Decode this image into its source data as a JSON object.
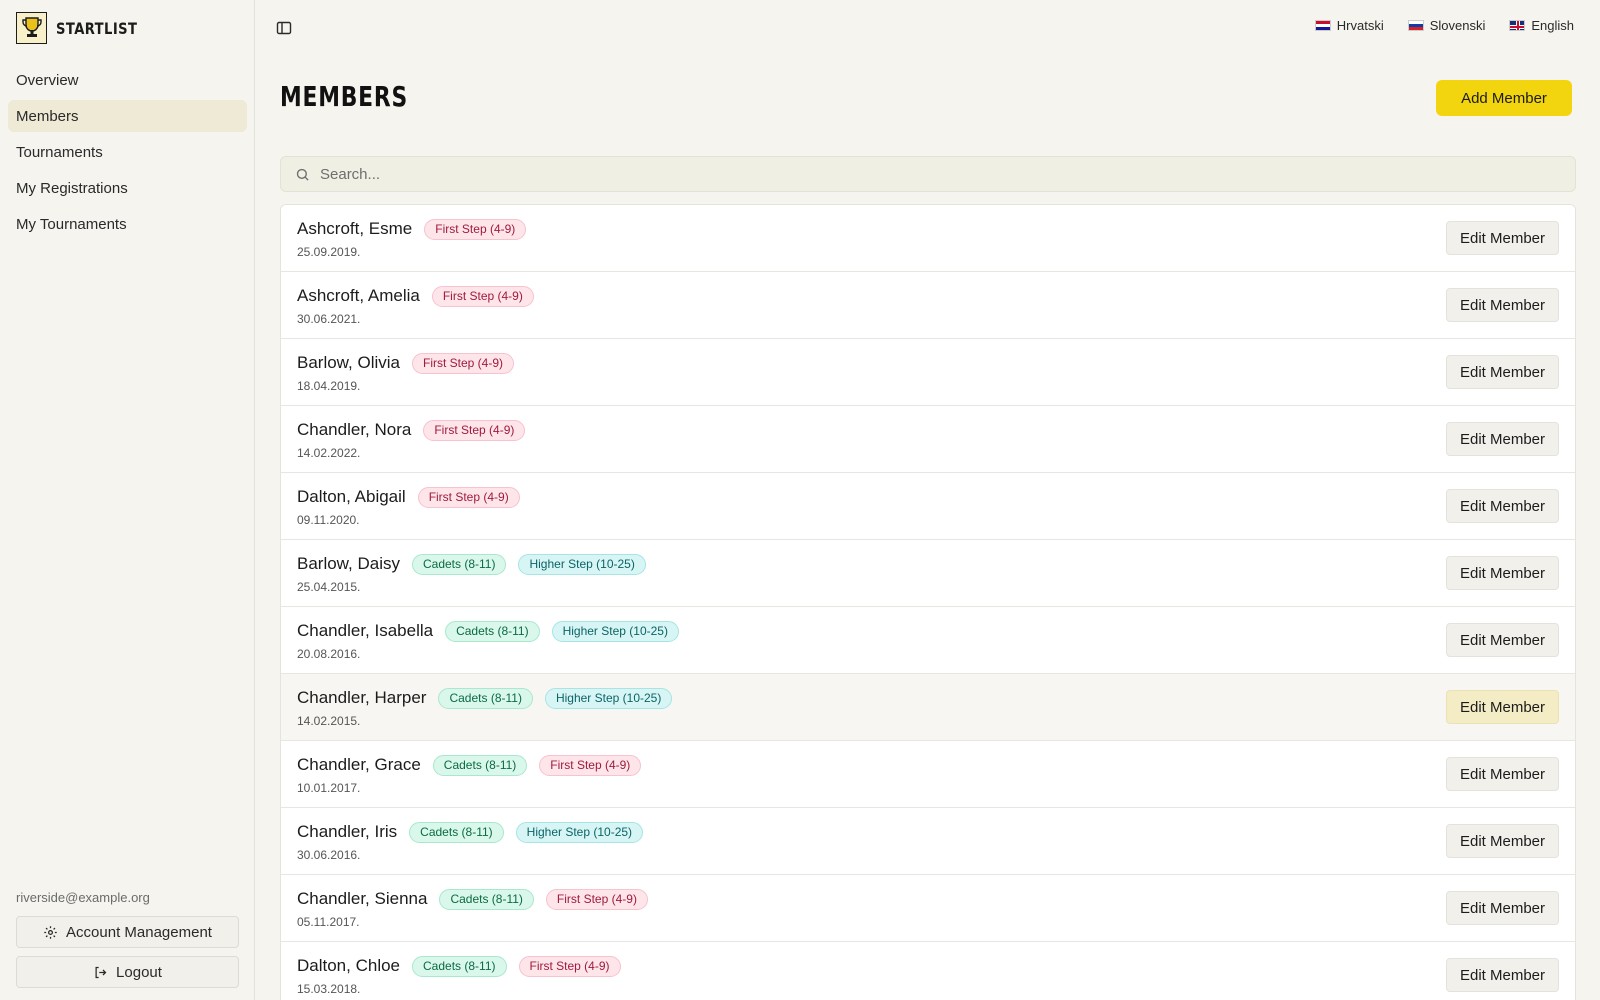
{
  "app": {
    "name": "STARTLIST"
  },
  "sidebar": {
    "items": [
      {
        "label": "Overview",
        "active": false
      },
      {
        "label": "Members",
        "active": true
      },
      {
        "label": "Tournaments",
        "active": false
      },
      {
        "label": "My Registrations",
        "active": false
      },
      {
        "label": "My Tournaments",
        "active": false
      }
    ],
    "user_email": "riverside@example.org",
    "account_label": "Account Management",
    "logout_label": "Logout"
  },
  "languages": [
    {
      "label": "Hrvatski",
      "flag": "hr"
    },
    {
      "label": "Slovenski",
      "flag": "si"
    },
    {
      "label": "English",
      "flag": "en"
    }
  ],
  "page": {
    "title": "MEMBERS",
    "add_label": "Add Member"
  },
  "search": {
    "placeholder": "Search..."
  },
  "members": [
    {
      "name": "Ashcroft, Esme",
      "date": "25.09.2019.",
      "badges": [
        {
          "text": "First Step (4-9)",
          "tone": "pink"
        }
      ]
    },
    {
      "name": "Ashcroft, Amelia",
      "date": "30.06.2021.",
      "badges": [
        {
          "text": "First Step (4-9)",
          "tone": "pink"
        }
      ]
    },
    {
      "name": "Barlow, Olivia",
      "date": "18.04.2019.",
      "badges": [
        {
          "text": "First Step (4-9)",
          "tone": "pink"
        }
      ]
    },
    {
      "name": "Chandler, Nora",
      "date": "14.02.2022.",
      "badges": [
        {
          "text": "First Step (4-9)",
          "tone": "pink"
        }
      ]
    },
    {
      "name": "Dalton, Abigail",
      "date": "09.11.2020.",
      "badges": [
        {
          "text": "First Step (4-9)",
          "tone": "pink"
        }
      ]
    },
    {
      "name": "Barlow, Daisy",
      "date": "25.04.2015.",
      "badges": [
        {
          "text": "Cadets (8-11)",
          "tone": "green"
        },
        {
          "text": "Higher Step (10-25)",
          "tone": "teal"
        }
      ]
    },
    {
      "name": "Chandler, Isabella",
      "date": "20.08.2016.",
      "badges": [
        {
          "text": "Cadets (8-11)",
          "tone": "green"
        },
        {
          "text": "Higher Step (10-25)",
          "tone": "teal"
        }
      ]
    },
    {
      "name": "Chandler, Harper",
      "date": "14.02.2015.",
      "hover": true,
      "badges": [
        {
          "text": "Cadets (8-11)",
          "tone": "green"
        },
        {
          "text": "Higher Step (10-25)",
          "tone": "teal"
        }
      ]
    },
    {
      "name": "Chandler, Grace",
      "date": "10.01.2017.",
      "badges": [
        {
          "text": "Cadets (8-11)",
          "tone": "green"
        },
        {
          "text": "First Step (4-9)",
          "tone": "pink"
        }
      ]
    },
    {
      "name": "Chandler, Iris",
      "date": "30.06.2016.",
      "badges": [
        {
          "text": "Cadets (8-11)",
          "tone": "green"
        },
        {
          "text": "Higher Step (10-25)",
          "tone": "teal"
        }
      ]
    },
    {
      "name": "Chandler, Sienna",
      "date": "05.11.2017.",
      "badges": [
        {
          "text": "Cadets (8-11)",
          "tone": "green"
        },
        {
          "text": "First Step (4-9)",
          "tone": "pink"
        }
      ]
    },
    {
      "name": "Dalton, Chloe",
      "date": "15.03.2018.",
      "badges": [
        {
          "text": "Cadets (8-11)",
          "tone": "green"
        },
        {
          "text": "First Step (4-9)",
          "tone": "pink"
        }
      ]
    }
  ],
  "edit_label": "Edit Member",
  "colors": {
    "accent": "#f2d50f",
    "active_nav": "#efead6",
    "background": "#f5f4ef"
  }
}
